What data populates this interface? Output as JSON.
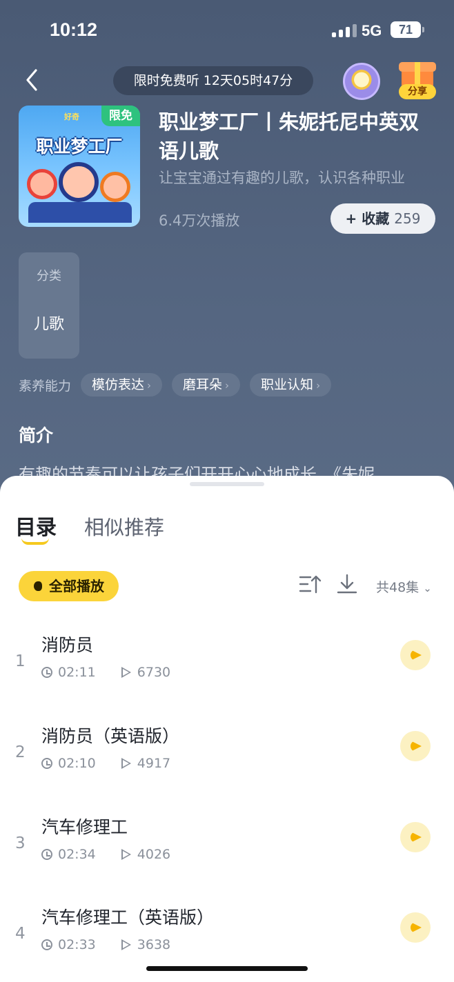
{
  "status_bar": {
    "time": "10:12",
    "network": "5G",
    "battery": "71"
  },
  "header": {
    "timer": "限时免费听 12天05时47分",
    "share_label": "分享"
  },
  "album": {
    "cover_title": "职业梦工厂",
    "cover_brand": "好奇",
    "cover_badge": "限免",
    "title": "职业梦工厂丨朱妮托尼中英双语儿歌",
    "subtitle": "让宝宝通过有趣的儿歌，认识各种职业",
    "plays": "6.4万次播放",
    "collect_label": "收藏",
    "collect_count": "259"
  },
  "category": {
    "key": "分类",
    "value": "儿歌"
  },
  "skills": {
    "label": "素养能力",
    "tags": [
      "模仿表达",
      "磨耳朵",
      "职业认知"
    ]
  },
  "intro": {
    "heading": "简介",
    "text": "有趣的节奏可以让孩子们开开心心地成长，《朱妮"
  },
  "sheet": {
    "tabs": [
      "目录",
      "相似推荐"
    ],
    "play_all": "全部播放",
    "episode_count": "共48集",
    "episodes": [
      {
        "num": "1",
        "name": "消防员",
        "duration": "02:11",
        "plays": "6730"
      },
      {
        "num": "2",
        "name": "消防员（英语版）",
        "duration": "02:10",
        "plays": "4917"
      },
      {
        "num": "3",
        "name": "汽车修理工",
        "duration": "02:34",
        "plays": "4026"
      },
      {
        "num": "4",
        "name": "汽车修理工（英语版）",
        "duration": "02:33",
        "plays": "3638"
      }
    ]
  }
}
